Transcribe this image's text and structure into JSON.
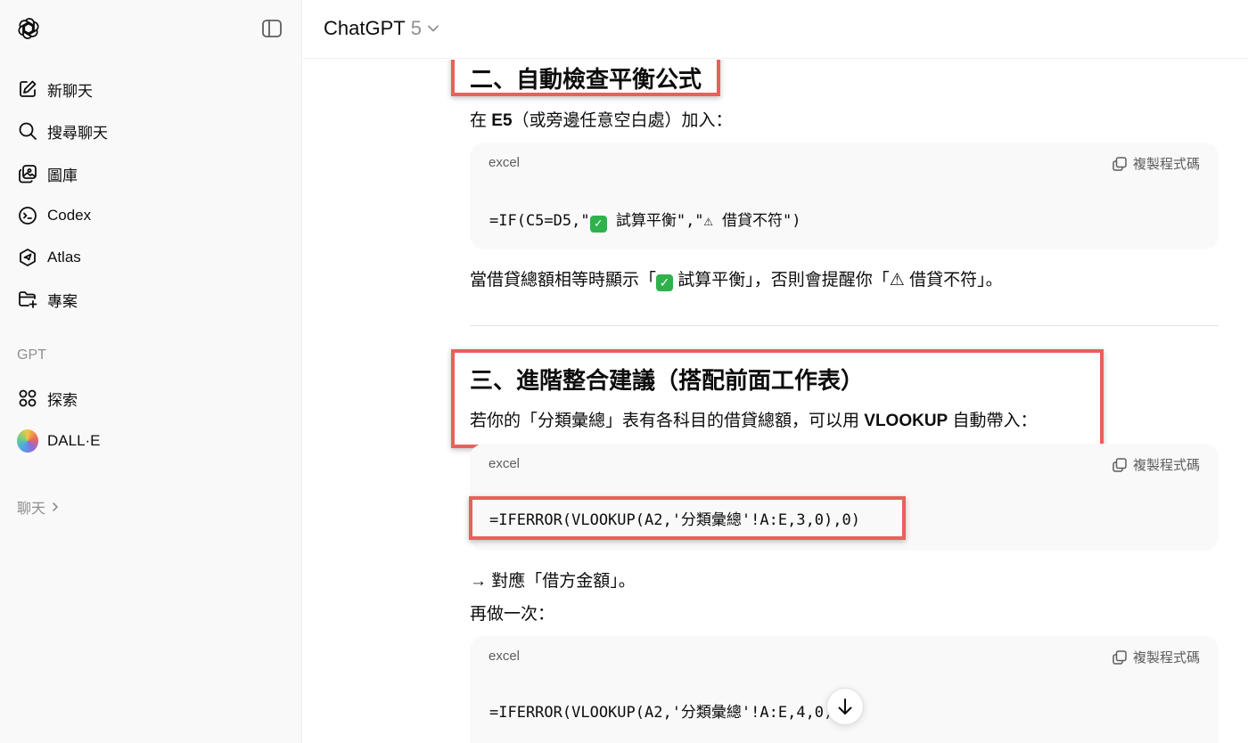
{
  "sidebar": {
    "nav_items": [
      {
        "label": "新聊天",
        "icon": "edit-icon"
      },
      {
        "label": "搜尋聊天",
        "icon": "search-icon"
      },
      {
        "label": "圖庫",
        "icon": "images-icon"
      },
      {
        "label": "Codex",
        "icon": "codex-icon"
      },
      {
        "label": "Atlas",
        "icon": "atlas-icon"
      },
      {
        "label": "專案",
        "icon": "folder-plus-icon"
      }
    ],
    "gpt_section_label": "GPT",
    "gpt_items": [
      {
        "label": "探索",
        "icon": "grid-icon"
      },
      {
        "label": "DALL·E",
        "icon": "dalle-avatar"
      }
    ],
    "chats_label": "聊天"
  },
  "header": {
    "model_name": "ChatGPT",
    "model_version": "5"
  },
  "content": {
    "section2": {
      "heading": "二、自動檢查平衡公式",
      "intro_prefix": "在 ",
      "intro_bold": "E5",
      "intro_suffix": "（或旁邊任意空白處）加入：",
      "code_lang": "excel",
      "copy_label": "複製程式碼",
      "code_part1": "=IF(C5=D5,\"",
      "code_part2": " 試算平衡\",\"⚠ 借貸不符\")",
      "explain_part1": "當借貸總額相等時顯示「",
      "explain_part2": " 試算平衡」，否則會提醒你「⚠ 借貸不符」。"
    },
    "section3": {
      "heading": "三、進階整合建議（搭配前面工作表）",
      "intro_prefix": "若你的「分類彙總」表有各科目的借貸總額，可以用 ",
      "intro_bold": "VLOOKUP",
      "intro_suffix": " 自動帶入：",
      "code_lang": "excel",
      "copy_label": "複製程式碼",
      "code": "=IFERROR(VLOOKUP(A2,'分類彙總'!A:E,3,0),0)",
      "note1": "→ 對應「借方金額」。",
      "note2": "再做一次：",
      "code2_lang": "excel",
      "code2_copy_label": "複製程式碼",
      "code2": "=IFERROR(VLOOKUP(A2,'分類彙總'!A:E,4,0),0)"
    }
  },
  "colors": {
    "highlight": "#e8615a",
    "check": "#2fb24c"
  }
}
